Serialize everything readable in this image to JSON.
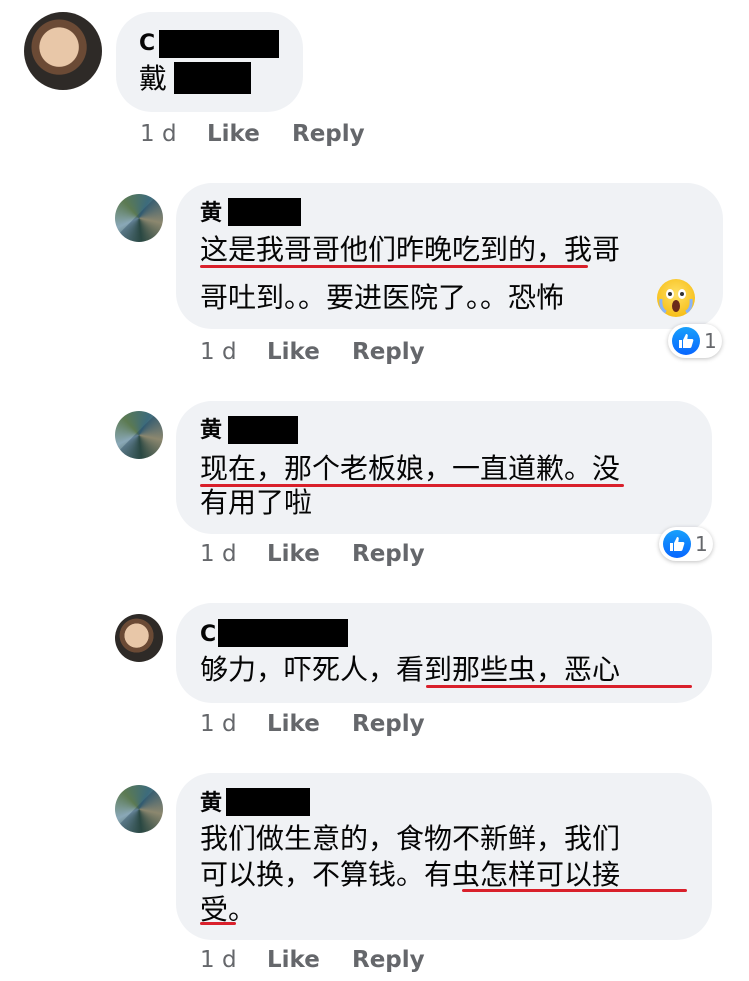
{
  "comments": [
    {
      "author_initial": "C",
      "text_lines": [
        "戴"
      ],
      "time": "1 d",
      "like_label": "Like",
      "reply_label": "Reply"
    },
    {
      "author_initial": "黄",
      "text_lines": [
        "这是我哥哥他们昨晚吃到的，我哥",
        "哥吐到。。要进医院了。。恐怖"
      ],
      "emoji": "scream-emoji",
      "time": "1 d",
      "like_label": "Like",
      "reply_label": "Reply",
      "reaction_count": "1"
    },
    {
      "author_initial": "黄",
      "text_lines": [
        "现在，那个老板娘，一直道歉。没",
        "有用了啦"
      ],
      "time": "1 d",
      "like_label": "Like",
      "reply_label": "Reply",
      "reaction_count": "1"
    },
    {
      "author_initial": "C",
      "text_lines": [
        "够力，吓死人，看到那些虫，恶心"
      ],
      "time": "1 d",
      "like_label": "Like",
      "reply_label": "Reply"
    },
    {
      "author_initial": "黄",
      "text_lines": [
        "我们做生意的，食物不新鲜，我们",
        "可以换，不算钱。有虫怎样可以接",
        "受。"
      ],
      "time": "1 d",
      "like_label": "Like",
      "reply_label": "Reply"
    }
  ],
  "colors": {
    "bubble": "#f0f2f5",
    "underline": "#d9202b",
    "meta_text": "#65676b",
    "like_blue": "#0866ff"
  }
}
